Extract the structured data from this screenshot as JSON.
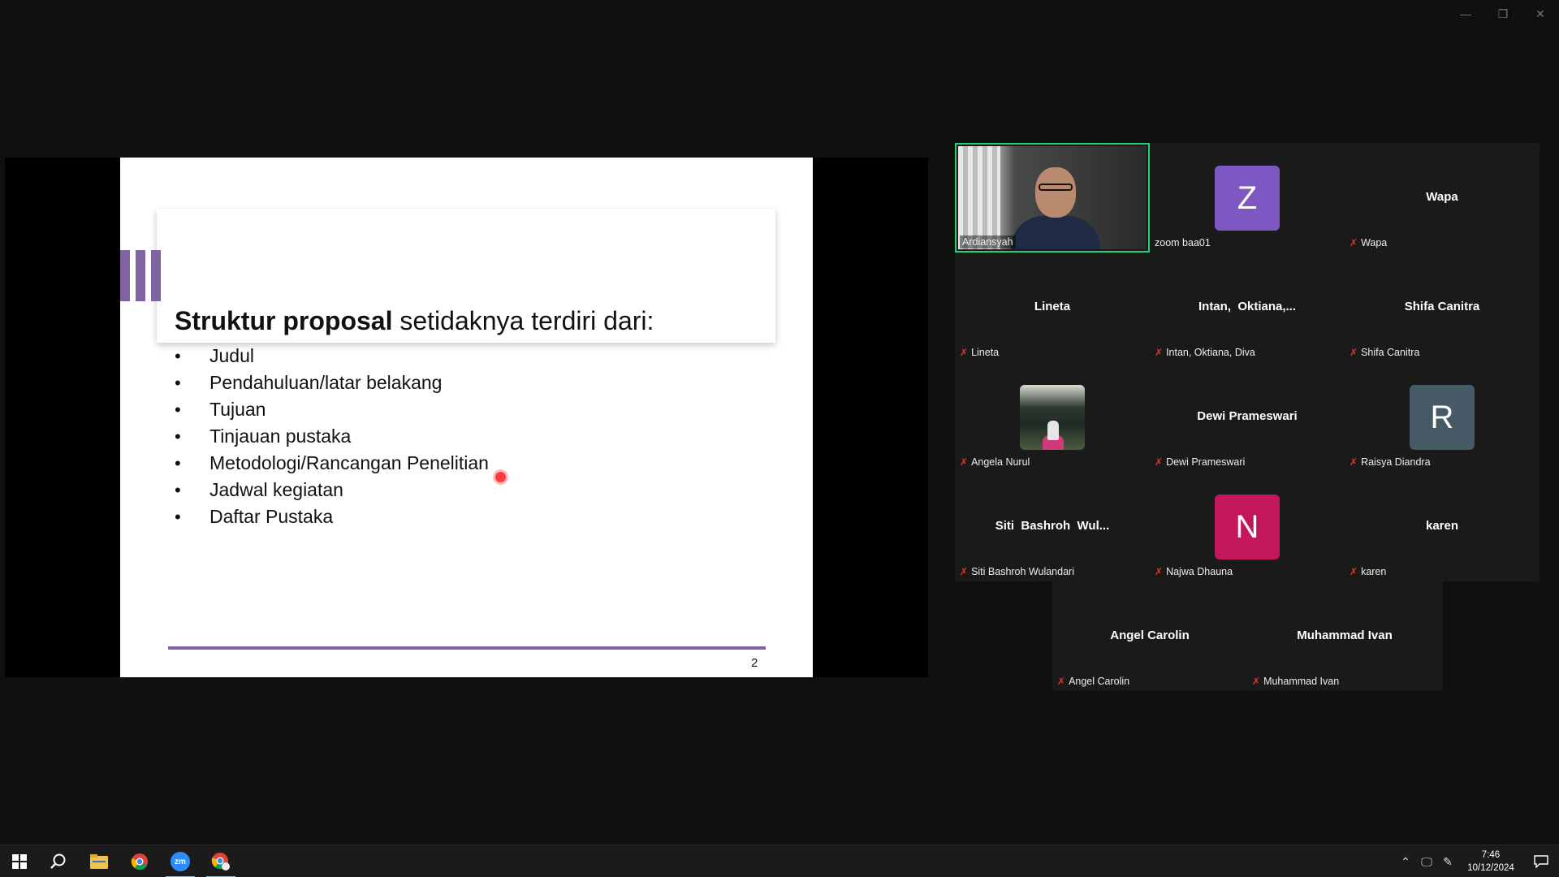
{
  "window": {
    "minimize": "—",
    "restore": "❐",
    "close": "✕"
  },
  "slide": {
    "title_bold": "Struktur proposal",
    "title_rest": " setidaknya terdiri dari:",
    "bullets": [
      "Judul",
      "Pendahuluan/latar belakang",
      "Tujuan",
      "Tinjauan pustaka",
      "Metodologi/Rancangan Penelitian",
      "Jadwal kegiatan",
      "Daftar Pustaka"
    ],
    "bullet_char": "•",
    "page_number": "2",
    "accent_color": "#8064a2"
  },
  "participants": [
    {
      "label": "Ardiansyah",
      "type": "video",
      "speaking": true
    },
    {
      "label": "zoom baa01",
      "type": "letter",
      "letter": "Z",
      "color": "#7e57c2",
      "muted": false
    },
    {
      "label": "Wapa",
      "display": "Wapa",
      "type": "name",
      "muted": true
    },
    {
      "label": "Lineta",
      "display": "Lineta",
      "type": "name",
      "muted": true
    },
    {
      "label": "Intan, Oktiana, Diva",
      "display": "Intan,  Oktiana,...",
      "type": "name",
      "muted": true
    },
    {
      "label": "Shifa Canitra",
      "display": "Shifa Canitra",
      "type": "name",
      "muted": true
    },
    {
      "label": "Angela Nurul",
      "type": "photo",
      "muted": true
    },
    {
      "label": "Dewi Prameswari",
      "display": "Dewi Prameswari",
      "type": "name",
      "muted": true
    },
    {
      "label": "Raisya Diandra",
      "type": "letter",
      "letter": "R",
      "color": "#455a64",
      "muted": true
    },
    {
      "label": "Siti Bashroh Wulandari",
      "display": "Siti  Bashroh  Wul...",
      "type": "name",
      "muted": true
    },
    {
      "label": "Najwa Dhauna",
      "type": "letter",
      "letter": "N",
      "color": "#c2185b",
      "muted": true
    },
    {
      "label": "karen",
      "display": "karen",
      "type": "name",
      "muted": true
    },
    {
      "label": "Angel Carolin",
      "display": "Angel Carolin",
      "type": "name",
      "muted": true
    },
    {
      "label": "Muhammad Ivan",
      "display": "Muhammad Ivan",
      "type": "name",
      "muted": true
    }
  ],
  "mute_icon": "🎤̸",
  "taskbar": {
    "apps": [
      "start-icon",
      "search-icon",
      "file-explorer-icon",
      "chrome-icon",
      "zoom-icon",
      "chrome-profile-icon"
    ],
    "zoom_label": "zm",
    "clock_time": "7:46",
    "clock_date": "10/12/2024"
  }
}
